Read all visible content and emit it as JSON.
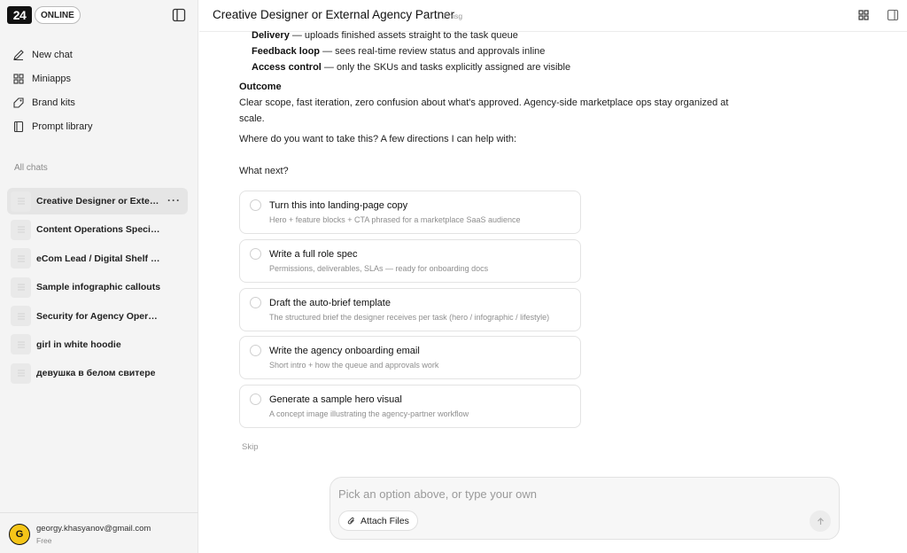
{
  "sidebar": {
    "logo_text": "24",
    "status_badge": "ONLINE",
    "nav": [
      {
        "label": "New chat",
        "icon": "new-chat-icon"
      },
      {
        "label": "Miniapps",
        "icon": "grid-icon"
      },
      {
        "label": "Brand kits",
        "icon": "brand-kit-icon"
      },
      {
        "label": "Prompt library",
        "icon": "book-icon"
      }
    ],
    "section_label": "All chats",
    "chats": [
      {
        "label": "Creative Designer or External Agency Partner",
        "active": true
      },
      {
        "label": "Content Operations Specialist"
      },
      {
        "label": "eCom Lead / Digital Shelf Manager"
      },
      {
        "label": "Sample infographic callouts"
      },
      {
        "label": "Security for Agency Operations"
      },
      {
        "label": "girl in white hoodie"
      },
      {
        "label": "девушка в белом свитере"
      }
    ],
    "more_glyph": "···",
    "user": {
      "initial": "G",
      "email": "georgy.khasyanov@gmail.com",
      "plan": "Free"
    }
  },
  "header": {
    "title": "Creative Designer or External Agency Partner",
    "msg_count": "2 msg"
  },
  "message": {
    "bullets": [
      {
        "term": "Delivery",
        "text": " — uploads finished assets straight to the task queue"
      },
      {
        "term": "Feedback loop",
        "text": " — sees real-time review status and approvals inline"
      },
      {
        "term": "Access control",
        "text": " — only the SKUs and tasks explicitly assigned are visible"
      }
    ],
    "outcome_heading": "Outcome",
    "outcome_line1": "Clear scope, fast iteration, zero confusion about what's approved. Agency-side marketplace ops stay organized at",
    "outcome_line2": "scale.",
    "directions": "Where do you want to take this? A few directions I can help with:",
    "next": "What next?"
  },
  "options": [
    {
      "title": "Turn this into landing-page copy",
      "subtitle": "Hero + feature blocks + CTA phrased for a marketplace SaaS audience"
    },
    {
      "title": "Write a full role spec",
      "subtitle": "Permissions, deliverables, SLAs — ready for onboarding docs"
    },
    {
      "title": "Draft the auto-brief template",
      "subtitle": "The structured brief the designer receives per task (hero / infographic / lifestyle)"
    },
    {
      "title": "Write the agency onboarding email",
      "subtitle": "Short intro + how the queue and approvals work"
    },
    {
      "title": "Generate a sample hero visual",
      "subtitle": "A concept image illustrating the agency-partner workflow"
    }
  ],
  "skip_label": "Skip",
  "composer": {
    "placeholder": "Pick an option above, or type your own",
    "attach_label": "Attach Files"
  }
}
